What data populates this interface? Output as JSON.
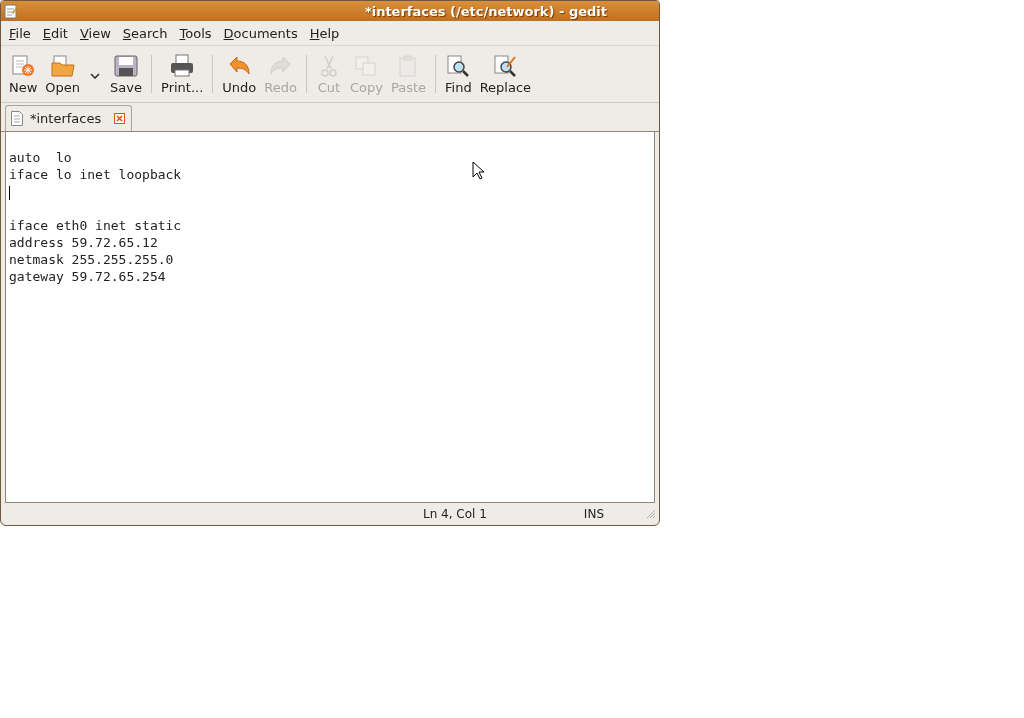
{
  "window": {
    "title": "*interfaces (/etc/network) - gedit"
  },
  "menu": [
    "File",
    "Edit",
    "View",
    "Search",
    "Tools",
    "Documents",
    "Help"
  ],
  "toolbar": [
    {
      "kind": "button",
      "label": "New",
      "disabled": false
    },
    {
      "kind": "button",
      "label": "Open",
      "disabled": false
    },
    {
      "kind": "dropdown"
    },
    {
      "kind": "button",
      "label": "Save",
      "disabled": false
    },
    {
      "kind": "separator"
    },
    {
      "kind": "button",
      "label": "Print...",
      "disabled": false
    },
    {
      "kind": "separator"
    },
    {
      "kind": "button",
      "label": "Undo",
      "disabled": false
    },
    {
      "kind": "button",
      "label": "Redo",
      "disabled": true
    },
    {
      "kind": "separator"
    },
    {
      "kind": "button",
      "label": "Cut",
      "disabled": true
    },
    {
      "kind": "button",
      "label": "Copy",
      "disabled": true
    },
    {
      "kind": "button",
      "label": "Paste",
      "disabled": true
    },
    {
      "kind": "separator"
    },
    {
      "kind": "button",
      "label": "Find",
      "disabled": false
    },
    {
      "kind": "button",
      "label": "Replace",
      "disabled": false
    }
  ],
  "tabs": [
    {
      "label": "*interfaces",
      "selected": true
    }
  ],
  "editor": {
    "lines": [
      {
        "kind": "blank"
      },
      {
        "kind": "text",
        "text": "auto  lo"
      },
      {
        "kind": "text",
        "text": "iface lo inet loopback"
      },
      {
        "kind": "caret"
      },
      {
        "kind": "blank"
      },
      {
        "kind": "text",
        "text": "iface eth0 inet static"
      },
      {
        "kind": "text",
        "text": "address 59.72.65.12"
      },
      {
        "kind": "text",
        "text": "netmask 255.255.255.0"
      },
      {
        "kind": "text",
        "text": "gateway 59.72.65.254"
      }
    ]
  },
  "status_bar": {
    "position": "Ln 4, Col 1",
    "mode": "INS"
  }
}
